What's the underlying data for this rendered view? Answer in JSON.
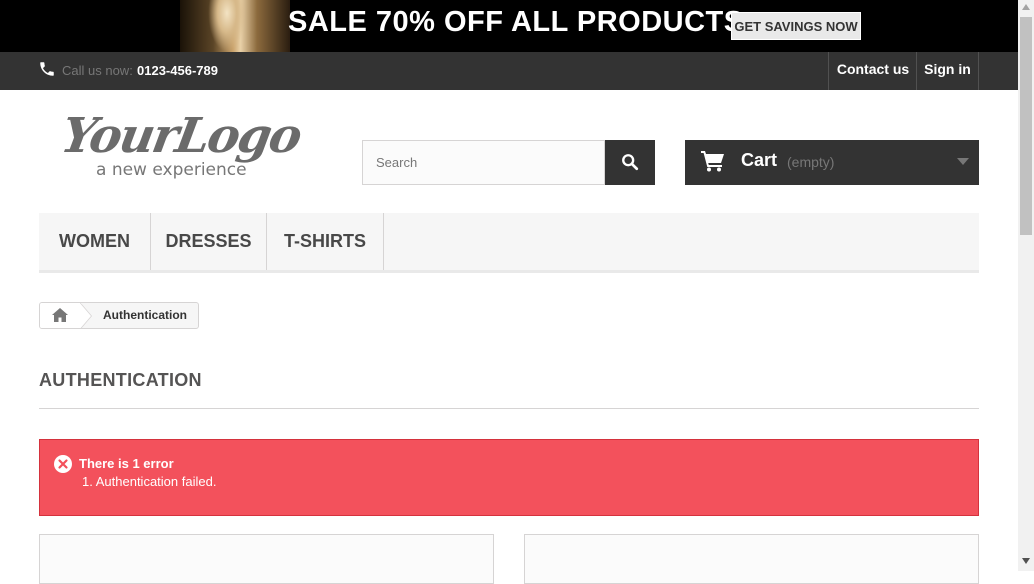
{
  "banner": {
    "text": "SALE 70% OFF ALL PRODUCTS",
    "button_label": "GET SAVINGS NOW"
  },
  "topbar": {
    "call_label": "Call us now:",
    "phone_number": "0123-456-789",
    "contact_label": "Contact us",
    "signin_label": "Sign in"
  },
  "logo": {
    "script_text": "YourLogo",
    "tagline": "a new experience"
  },
  "search": {
    "placeholder": "Search",
    "value": ""
  },
  "cart": {
    "label": "Cart",
    "status": "(empty)"
  },
  "menu": {
    "items": [
      {
        "label": "WOMEN"
      },
      {
        "label": "DRESSES"
      },
      {
        "label": "T-SHIRTS"
      }
    ]
  },
  "breadcrumb": {
    "current": "Authentication"
  },
  "page": {
    "heading": "AUTHENTICATION"
  },
  "alert": {
    "title": "There is 1 error",
    "items": [
      "1. Authentication failed."
    ]
  },
  "colors": {
    "dark_bar": "#333333",
    "alert_bg": "#f3515c",
    "menu_bg": "#f6f6f6"
  },
  "icons": {
    "phone": "phone-icon",
    "search": "search-icon",
    "cart": "shopping-cart-icon",
    "caret": "caret-down-icon",
    "home": "home-icon",
    "error": "error-circle-icon"
  }
}
